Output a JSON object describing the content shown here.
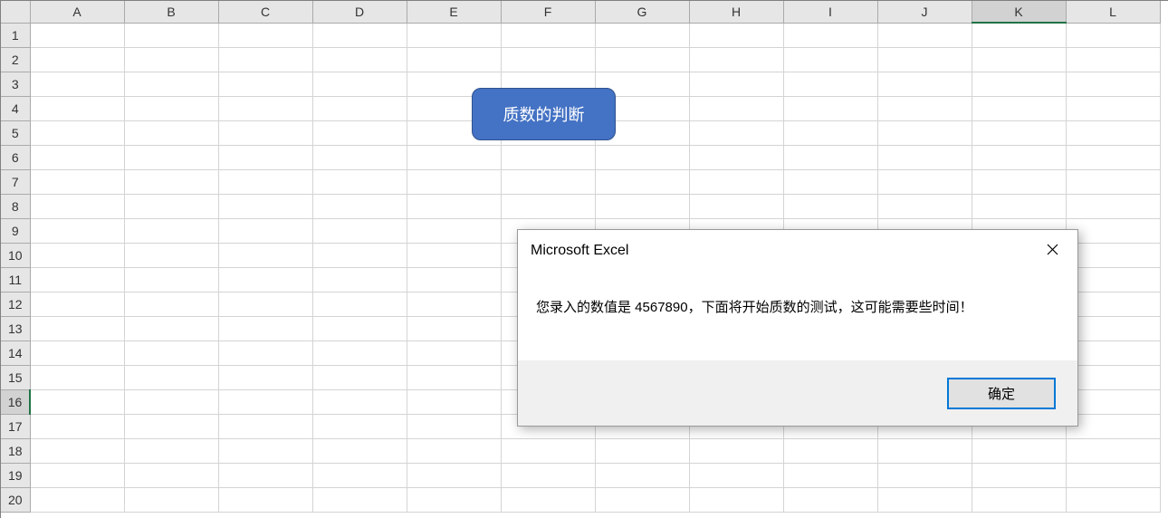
{
  "columns": [
    "A",
    "B",
    "C",
    "D",
    "E",
    "F",
    "G",
    "H",
    "I",
    "J",
    "K",
    "L"
  ],
  "rows": [
    "1",
    "2",
    "3",
    "4",
    "5",
    "6",
    "7",
    "8",
    "9",
    "10",
    "11",
    "12",
    "13",
    "14",
    "15",
    "16",
    "17",
    "18",
    "19",
    "20"
  ],
  "selected_column": "K",
  "selected_row": "16",
  "shape": {
    "label": "质数的判断"
  },
  "dialog": {
    "title": "Microsoft Excel",
    "message": "您录入的数值是 4567890，下面将开始质数的测试，这可能需要些时间！",
    "ok_label": "确定"
  }
}
